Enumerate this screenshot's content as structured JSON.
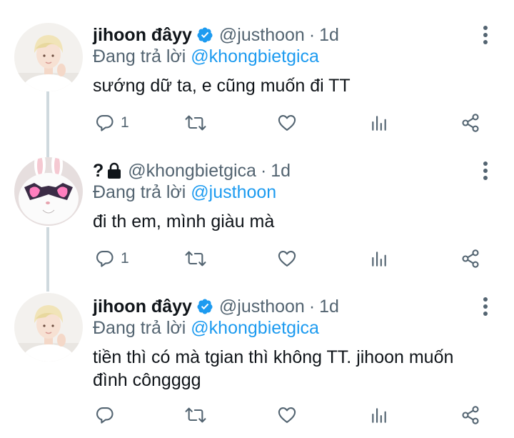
{
  "tweets": [
    {
      "name": "jihoon đâyy",
      "verified": true,
      "handle": "@justhoon",
      "dot": "·",
      "time": "1d",
      "reply_prefix": "Đang trả lời",
      "reply_to": "@khongbietgica",
      "text": "sướng dữ ta, e cũng muốn đi TT",
      "reply_count": "1",
      "avatar": "blond-person-avatar"
    },
    {
      "name": "?",
      "protected": true,
      "handle": "@khongbietgica",
      "dot": "·",
      "time": "1d",
      "reply_prefix": "Đang trả lời",
      "reply_to": "@justhoon",
      "text": "đi th em, mình giàu mà",
      "reply_count": "1",
      "avatar": "bunny-sunglasses-avatar"
    },
    {
      "name": "jihoon đâyy",
      "verified": true,
      "handle": "@justhoon",
      "dot": "·",
      "time": "1d",
      "reply_prefix": "Đang trả lời",
      "reply_to": "@khongbietgica",
      "text": "tiền thì có mà tgian thì không TT. jihoon muốn đình côngggg",
      "reply_count": "",
      "avatar": "blond-person-avatar"
    }
  ],
  "colors": {
    "text": "#0f1419",
    "muted": "#536471",
    "link": "#1d9bf0",
    "thread": "#cfd9de"
  },
  "icons": [
    "reply-icon",
    "retweet-icon",
    "like-icon",
    "analytics-icon",
    "share-icon",
    "more-icon",
    "verified-badge-icon",
    "lock-icon"
  ]
}
